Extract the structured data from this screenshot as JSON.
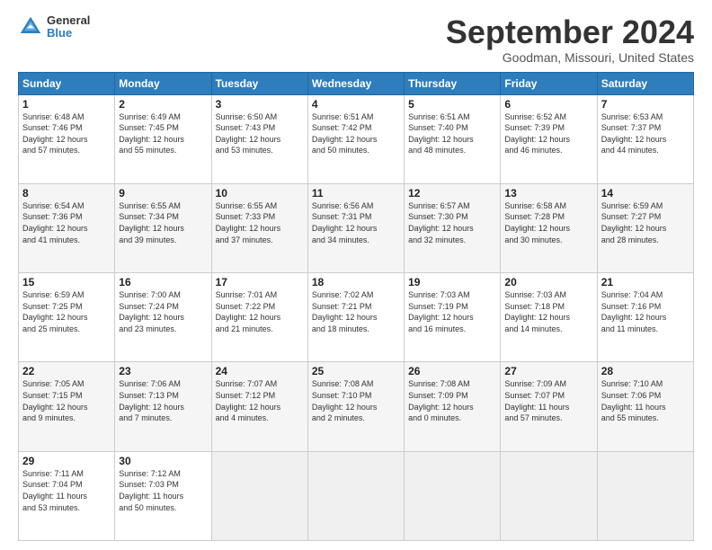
{
  "header": {
    "logo_line1": "General",
    "logo_line2": "Blue",
    "title": "September 2024",
    "subtitle": "Goodman, Missouri, United States"
  },
  "columns": [
    "Sunday",
    "Monday",
    "Tuesday",
    "Wednesday",
    "Thursday",
    "Friday",
    "Saturday"
  ],
  "weeks": [
    [
      {
        "day": "1",
        "info": "Sunrise: 6:48 AM\nSunset: 7:46 PM\nDaylight: 12 hours\nand 57 minutes.",
        "shade": false
      },
      {
        "day": "2",
        "info": "Sunrise: 6:49 AM\nSunset: 7:45 PM\nDaylight: 12 hours\nand 55 minutes.",
        "shade": false
      },
      {
        "day": "3",
        "info": "Sunrise: 6:50 AM\nSunset: 7:43 PM\nDaylight: 12 hours\nand 53 minutes.",
        "shade": false
      },
      {
        "day": "4",
        "info": "Sunrise: 6:51 AM\nSunset: 7:42 PM\nDaylight: 12 hours\nand 50 minutes.",
        "shade": false
      },
      {
        "day": "5",
        "info": "Sunrise: 6:51 AM\nSunset: 7:40 PM\nDaylight: 12 hours\nand 48 minutes.",
        "shade": false
      },
      {
        "day": "6",
        "info": "Sunrise: 6:52 AM\nSunset: 7:39 PM\nDaylight: 12 hours\nand 46 minutes.",
        "shade": false
      },
      {
        "day": "7",
        "info": "Sunrise: 6:53 AM\nSunset: 7:37 PM\nDaylight: 12 hours\nand 44 minutes.",
        "shade": false
      }
    ],
    [
      {
        "day": "8",
        "info": "Sunrise: 6:54 AM\nSunset: 7:36 PM\nDaylight: 12 hours\nand 41 minutes.",
        "shade": true
      },
      {
        "day": "9",
        "info": "Sunrise: 6:55 AM\nSunset: 7:34 PM\nDaylight: 12 hours\nand 39 minutes.",
        "shade": true
      },
      {
        "day": "10",
        "info": "Sunrise: 6:55 AM\nSunset: 7:33 PM\nDaylight: 12 hours\nand 37 minutes.",
        "shade": true
      },
      {
        "day": "11",
        "info": "Sunrise: 6:56 AM\nSunset: 7:31 PM\nDaylight: 12 hours\nand 34 minutes.",
        "shade": true
      },
      {
        "day": "12",
        "info": "Sunrise: 6:57 AM\nSunset: 7:30 PM\nDaylight: 12 hours\nand 32 minutes.",
        "shade": true
      },
      {
        "day": "13",
        "info": "Sunrise: 6:58 AM\nSunset: 7:28 PM\nDaylight: 12 hours\nand 30 minutes.",
        "shade": true
      },
      {
        "day": "14",
        "info": "Sunrise: 6:59 AM\nSunset: 7:27 PM\nDaylight: 12 hours\nand 28 minutes.",
        "shade": true
      }
    ],
    [
      {
        "day": "15",
        "info": "Sunrise: 6:59 AM\nSunset: 7:25 PM\nDaylight: 12 hours\nand 25 minutes.",
        "shade": false
      },
      {
        "day": "16",
        "info": "Sunrise: 7:00 AM\nSunset: 7:24 PM\nDaylight: 12 hours\nand 23 minutes.",
        "shade": false
      },
      {
        "day": "17",
        "info": "Sunrise: 7:01 AM\nSunset: 7:22 PM\nDaylight: 12 hours\nand 21 minutes.",
        "shade": false
      },
      {
        "day": "18",
        "info": "Sunrise: 7:02 AM\nSunset: 7:21 PM\nDaylight: 12 hours\nand 18 minutes.",
        "shade": false
      },
      {
        "day": "19",
        "info": "Sunrise: 7:03 AM\nSunset: 7:19 PM\nDaylight: 12 hours\nand 16 minutes.",
        "shade": false
      },
      {
        "day": "20",
        "info": "Sunrise: 7:03 AM\nSunset: 7:18 PM\nDaylight: 12 hours\nand 14 minutes.",
        "shade": false
      },
      {
        "day": "21",
        "info": "Sunrise: 7:04 AM\nSunset: 7:16 PM\nDaylight: 12 hours\nand 11 minutes.",
        "shade": false
      }
    ],
    [
      {
        "day": "22",
        "info": "Sunrise: 7:05 AM\nSunset: 7:15 PM\nDaylight: 12 hours\nand 9 minutes.",
        "shade": true
      },
      {
        "day": "23",
        "info": "Sunrise: 7:06 AM\nSunset: 7:13 PM\nDaylight: 12 hours\nand 7 minutes.",
        "shade": true
      },
      {
        "day": "24",
        "info": "Sunrise: 7:07 AM\nSunset: 7:12 PM\nDaylight: 12 hours\nand 4 minutes.",
        "shade": true
      },
      {
        "day": "25",
        "info": "Sunrise: 7:08 AM\nSunset: 7:10 PM\nDaylight: 12 hours\nand 2 minutes.",
        "shade": true
      },
      {
        "day": "26",
        "info": "Sunrise: 7:08 AM\nSunset: 7:09 PM\nDaylight: 12 hours\nand 0 minutes.",
        "shade": true
      },
      {
        "day": "27",
        "info": "Sunrise: 7:09 AM\nSunset: 7:07 PM\nDaylight: 11 hours\nand 57 minutes.",
        "shade": true
      },
      {
        "day": "28",
        "info": "Sunrise: 7:10 AM\nSunset: 7:06 PM\nDaylight: 11 hours\nand 55 minutes.",
        "shade": true
      }
    ],
    [
      {
        "day": "29",
        "info": "Sunrise: 7:11 AM\nSunset: 7:04 PM\nDaylight: 11 hours\nand 53 minutes.",
        "shade": false
      },
      {
        "day": "30",
        "info": "Sunrise: 7:12 AM\nSunset: 7:03 PM\nDaylight: 11 hours\nand 50 minutes.",
        "shade": false
      },
      {
        "day": "",
        "info": "",
        "shade": false,
        "empty": true
      },
      {
        "day": "",
        "info": "",
        "shade": false,
        "empty": true
      },
      {
        "day": "",
        "info": "",
        "shade": false,
        "empty": true
      },
      {
        "day": "",
        "info": "",
        "shade": false,
        "empty": true
      },
      {
        "day": "",
        "info": "",
        "shade": false,
        "empty": true
      }
    ]
  ]
}
